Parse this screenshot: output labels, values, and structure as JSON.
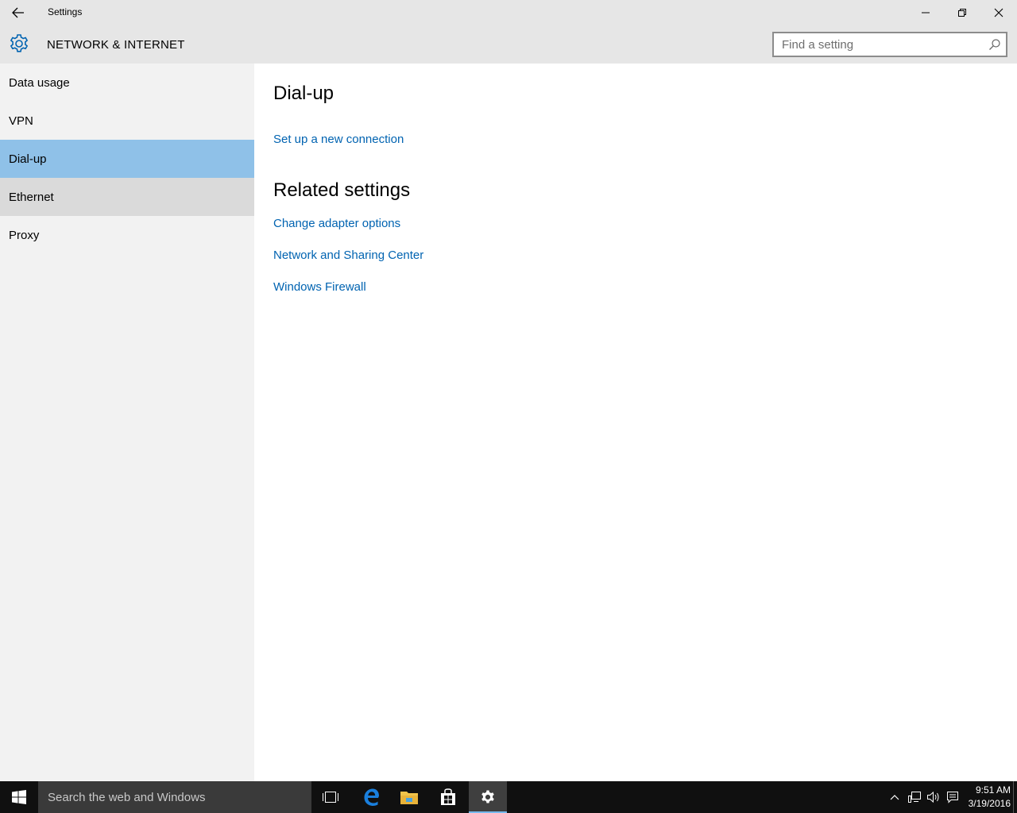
{
  "window": {
    "title": "Settings"
  },
  "header": {
    "section_title": "NETWORK & INTERNET",
    "search_placeholder": "Find a setting"
  },
  "sidebar": {
    "items": [
      {
        "label": "Data usage",
        "state": "normal"
      },
      {
        "label": "VPN",
        "state": "normal"
      },
      {
        "label": "Dial-up",
        "state": "selected"
      },
      {
        "label": "Ethernet",
        "state": "hover"
      },
      {
        "label": "Proxy",
        "state": "normal"
      }
    ]
  },
  "main": {
    "title": "Dial-up",
    "setup_link": "Set up a new connection",
    "related_heading": "Related settings",
    "related_links": [
      "Change adapter options",
      "Network and Sharing Center",
      "Windows Firewall"
    ]
  },
  "taskbar": {
    "search_text": "Search the web and Windows",
    "time": "9:51 AM",
    "date": "3/19/2016"
  },
  "colors": {
    "accent": "#0063b1",
    "selected": "#8fc1e8",
    "hover": "#dadada",
    "taskbar": "#101010"
  }
}
